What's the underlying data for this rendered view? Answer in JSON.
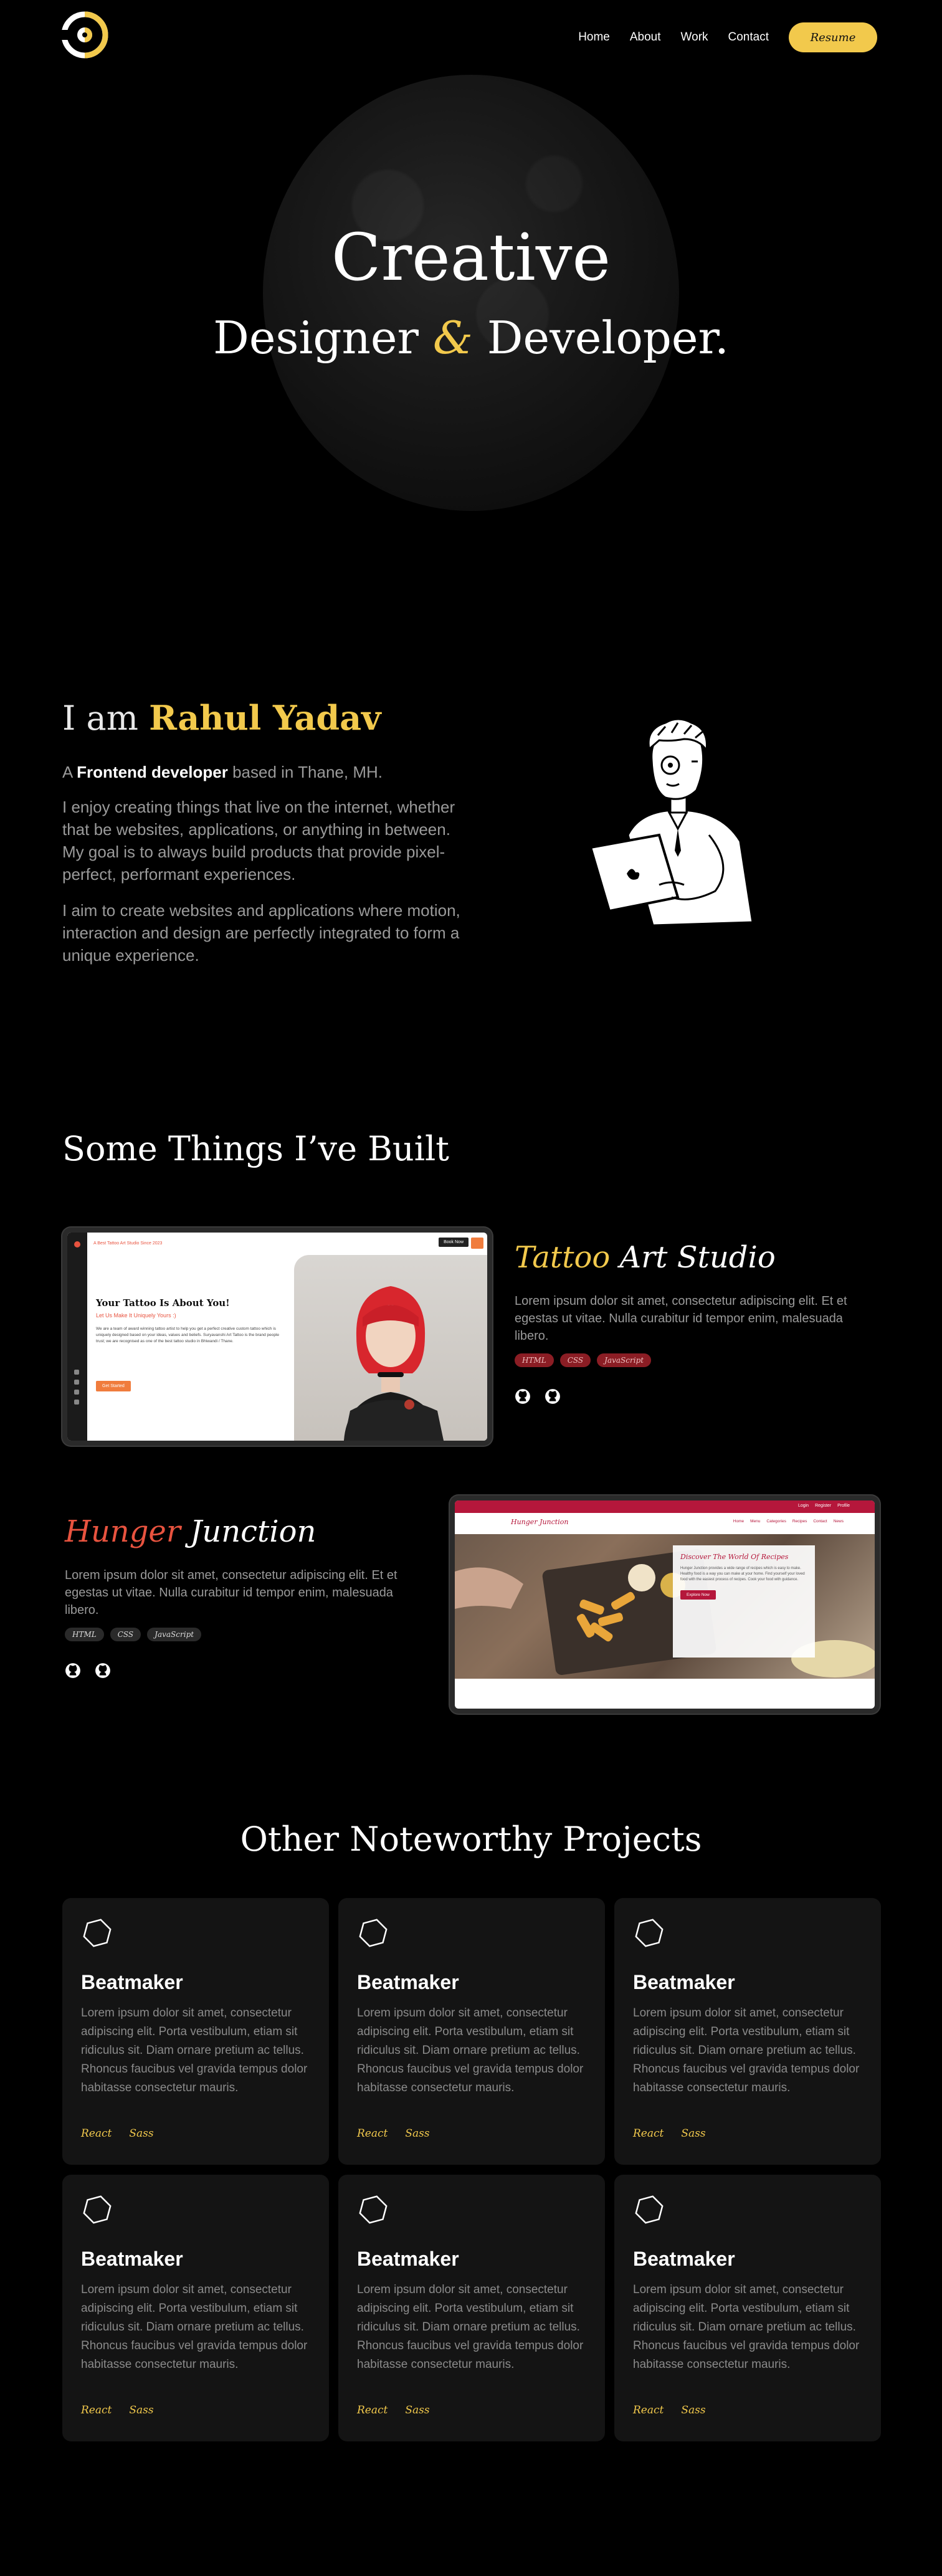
{
  "nav": {
    "links": [
      "Home",
      "About",
      "Work",
      "Contact"
    ],
    "resume": "Resume"
  },
  "hero": {
    "title": "Creative",
    "sub_left": "Designer",
    "amp": "&",
    "sub_right": "Developer."
  },
  "about": {
    "heading_prefix": "I am",
    "name": "Rahul Yadav",
    "role_a": "A",
    "role_b": "Frontend developer",
    "role_c": "based in Thane, MH.",
    "p1": "I enjoy creating things that live on the internet, whether that be websites, applications, or anything in between. My goal is to always build products that provide pixel-perfect, performant experiences.",
    "p2": "I aim to create websites and applications where motion, interaction and design are perfectly integrated to form a unique experience."
  },
  "built": {
    "title": "Some Things I’ve Built",
    "projects": [
      {
        "title_a": "Tattoo",
        "title_b": "Art Studio",
        "desc": "Lorem ipsum dolor sit amet, consectetur adipiscing elit. Et et egestas ut vitae. Nulla curabitur id tempor enim, malesuada libero.",
        "tags": [
          "HTML",
          "CSS",
          "JavaScript"
        ],
        "screen": {
          "nav_text": "A Best Tattoo Art Studio Since 2023",
          "btn": "Book Now",
          "headline": "Your Tattoo Is About You!",
          "subline": "Let Us Make It Uniquely Yours :)",
          "body": "We are a team of award winning tattoo artist to help you get a perfect creative custom tattoo which is uniquely designed based on your ideas, values and beliefs. Suryavanshi Art Tattoo is the brand people trust; we are recognised as one of the best tattoo studio in Bhiwandi / Thane.",
          "cta": "Get Started"
        }
      },
      {
        "title_a": "Hunger",
        "title_b": "Junction",
        "desc": "Lorem ipsum dolor sit amet, consectetur adipiscing elit. Et et egestas ut vitae. Nulla curabitur id tempor enim, malesuada libero.",
        "tags": [
          "HTML",
          "CSS",
          "JavaScript"
        ],
        "screen": {
          "top_links": [
            "Login",
            "Register",
            "Profile"
          ],
          "logo": "Hunger Junction",
          "menu": [
            "Home",
            "Menu",
            "Categories",
            "Recipes",
            "Contact",
            "News"
          ],
          "card_title": "Discover The World Of Recipes",
          "card_body": "Hunger Junction provides a wide range of recipes which is easy to make. Healthy food is a way you can make at your home. Find yourself your loved food with the easiest process of recipes. Cook your food with guidance.",
          "card_btn": "Explore Now"
        }
      }
    ]
  },
  "noteworthy": {
    "title": "Other Noteworthy Projects",
    "cards": [
      {
        "title": "Beatmaker",
        "desc": "Lorem ipsum dolor sit amet, consectetur adipiscing elit. Porta vestibulum, etiam sit ridiculus sit. Diam ornare pretium ac tellus. Rhoncus faucibus vel gravida tempus dolor habitasse consectetur mauris.",
        "tags": [
          "React",
          "Sass"
        ]
      },
      {
        "title": "Beatmaker",
        "desc": "Lorem ipsum dolor sit amet, consectetur adipiscing elit. Porta vestibulum, etiam sit ridiculus sit. Diam ornare pretium ac tellus. Rhoncus faucibus vel gravida tempus dolor habitasse consectetur mauris.",
        "tags": [
          "React",
          "Sass"
        ]
      },
      {
        "title": "Beatmaker",
        "desc": "Lorem ipsum dolor sit amet, consectetur adipiscing elit. Porta vestibulum, etiam sit ridiculus sit. Diam ornare pretium ac tellus. Rhoncus faucibus vel gravida tempus dolor habitasse consectetur mauris.",
        "tags": [
          "React",
          "Sass"
        ]
      },
      {
        "title": "Beatmaker",
        "desc": "Lorem ipsum dolor sit amet, consectetur adipiscing elit. Porta vestibulum, etiam sit ridiculus sit. Diam ornare pretium ac tellus. Rhoncus faucibus vel gravida tempus dolor habitasse consectetur mauris.",
        "tags": [
          "React",
          "Sass"
        ]
      },
      {
        "title": "Beatmaker",
        "desc": "Lorem ipsum dolor sit amet, consectetur adipiscing elit. Porta vestibulum, etiam sit ridiculus sit. Diam ornare pretium ac tellus. Rhoncus faucibus vel gravida tempus dolor habitasse consectetur mauris.",
        "tags": [
          "React",
          "Sass"
        ]
      },
      {
        "title": "Beatmaker",
        "desc": "Lorem ipsum dolor sit amet, consectetur adipiscing elit. Porta vestibulum, etiam sit ridiculus sit. Diam ornare pretium ac tellus. Rhoncus faucibus vel gravida tempus dolor habitasse consectetur mauris.",
        "tags": [
          "React",
          "Sass"
        ]
      }
    ]
  },
  "colors": {
    "accent": "#f2c94c",
    "red_accent": "#e8533f",
    "background": "#000000",
    "card": "#141414"
  }
}
